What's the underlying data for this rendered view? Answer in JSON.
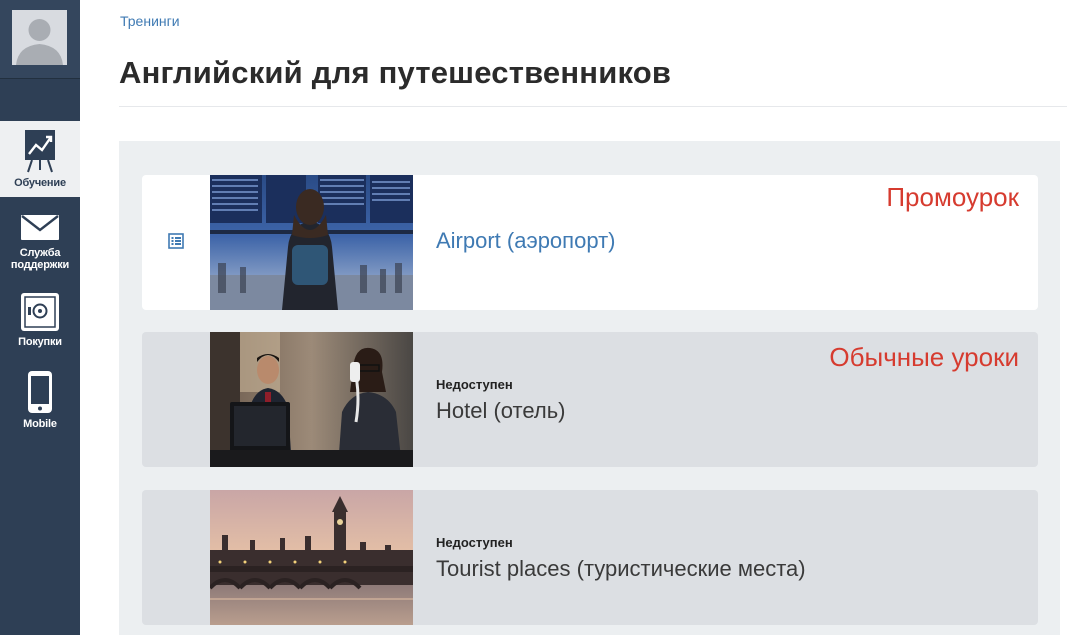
{
  "sidebar": {
    "items": [
      {
        "label": "Обучение",
        "icon": "chart-board-icon",
        "active": true
      },
      {
        "label": "Служба поддержки",
        "icon": "envelope-icon",
        "active": false
      },
      {
        "label": "Покупки",
        "icon": "safe-icon",
        "active": false
      },
      {
        "label": "Mobile",
        "icon": "smartphone-icon",
        "active": false
      }
    ]
  },
  "breadcrumb": "Тренинги",
  "page_title": "Английский для путешественников",
  "lessons": [
    {
      "title": "Airport (аэропорт)",
      "status": "",
      "available": true,
      "annotation": "Промоурок",
      "icon": "list-icon"
    },
    {
      "title": "Hotel (отель)",
      "status": "Недоступен",
      "available": false,
      "annotation": "Обычные уроки"
    },
    {
      "title": "Tourist places (туристические места)",
      "status": "Недоступен",
      "available": false,
      "annotation": ""
    }
  ],
  "colors": {
    "sidebar_bg": "#2e3f55",
    "link": "#3f7ab3",
    "annotation": "#d63b2f",
    "locked_card_bg": "#dcdfe3",
    "panel_bg": "#eceff1"
  }
}
